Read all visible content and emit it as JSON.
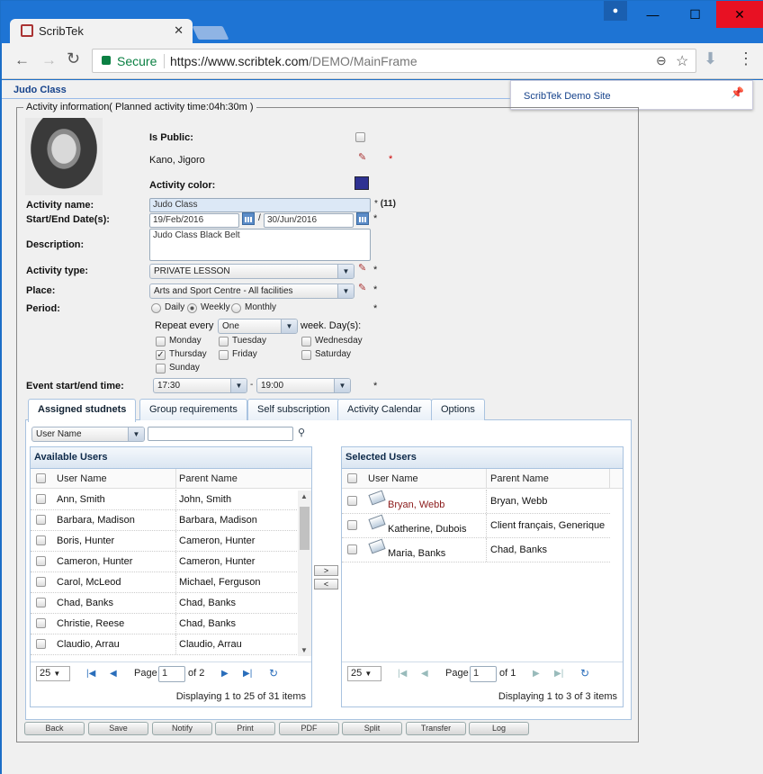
{
  "browser": {
    "tab_title": "ScribTek",
    "tab_close": "✕",
    "secure_label": "Secure",
    "url_prefix": "https://www.scribtek.com",
    "url_path": "/DEMO/MainFrame",
    "win_min": "—",
    "win_max": "☐",
    "win_close": "✕"
  },
  "page": {
    "title": "Judo Class",
    "tooltip": "ScribTek Demo Site",
    "fieldset_legend": "Activity information( Planned activity time:04h:30m )"
  },
  "form": {
    "is_public_label": "Is Public:",
    "owner_name": "Kano, Jigoro",
    "activity_color_label": "Activity color:",
    "activity_color": "#2e3192",
    "activity_name_label": "Activity name:",
    "activity_name_value": "Judo Class",
    "activity_name_count": "(11)",
    "dates_label": "Start/End Date(s):",
    "start_date": "19/Feb/2016",
    "end_date": "30/Jun/2016",
    "date_separator": "/",
    "description_label": "Description:",
    "description_value": "Judo Class Black Belt",
    "activity_type_label": "Activity type:",
    "activity_type_value": "PRIVATE LESSON",
    "place_label": "Place:",
    "place_value": "Arts and Sport Centre - All facilities",
    "period_label": "Period:",
    "period_options": [
      "Daily",
      "Weekly",
      "Monthly"
    ],
    "period_selected": "Weekly",
    "repeat_every_label": "Repeat every",
    "repeat_every_value": "One",
    "week_days_label": "week. Day(s):",
    "days": [
      "Monday",
      "Tuesday",
      "Wednesday",
      "Thursday",
      "Friday",
      "Saturday",
      "Sunday"
    ],
    "days_checked": [
      "Thursday"
    ],
    "event_time_label": "Event start/end time:",
    "start_time": "17:30",
    "end_time": "19:00",
    "time_separator": "-",
    "required_mark": "*"
  },
  "tabs": [
    "Assigned studnets",
    "Group requirements",
    "Self subscription",
    "Activity Calendar",
    "Options"
  ],
  "filter": {
    "field": "User Name",
    "value": ""
  },
  "available": {
    "title": "Available Users",
    "col_user": "User Name",
    "col_parent": "Parent Name",
    "rows": [
      {
        "user": "Ann, Smith",
        "parent": "John, Smith"
      },
      {
        "user": "Barbara, Madison",
        "parent": "Barbara, Madison"
      },
      {
        "user": "Boris, Hunter",
        "parent": "Cameron, Hunter"
      },
      {
        "user": "Cameron, Hunter",
        "parent": "Cameron, Hunter"
      },
      {
        "user": "Carol, McLeod",
        "parent": "Michael, Ferguson"
      },
      {
        "user": "Chad, Banks",
        "parent": "Chad, Banks"
      },
      {
        "user": "Christie, Reese",
        "parent": "Chad, Banks"
      },
      {
        "user": "Claudio, Arrau",
        "parent": "Claudio, Arrau"
      }
    ],
    "page_size": "25",
    "page_label": "Page",
    "page": "1",
    "of_pages": "of 2",
    "displaying": "Displaying 1 to 25 of 31 items"
  },
  "transfer": {
    "add": ">",
    "remove": "<"
  },
  "selected": {
    "title": "Selected Users",
    "col_user": "User Name",
    "col_parent": "Parent Name",
    "rows": [
      {
        "user": "Bryan, Webb",
        "parent": "Bryan, Webb",
        "highlight": true
      },
      {
        "user": "Katherine, Dubois",
        "parent": "Client français, Generique",
        "highlight": false
      },
      {
        "user": "Maria, Banks",
        "parent": "Chad, Banks",
        "highlight": false
      }
    ],
    "page_size": "25",
    "page_label": "Page",
    "page": "1",
    "of_pages": "of 1",
    "displaying": "Displaying 1 to 3 of 3 items"
  },
  "buttons": [
    "Back",
    "Save",
    "Notify",
    "Print",
    "PDF",
    "Split",
    "Transfer",
    "Log"
  ]
}
